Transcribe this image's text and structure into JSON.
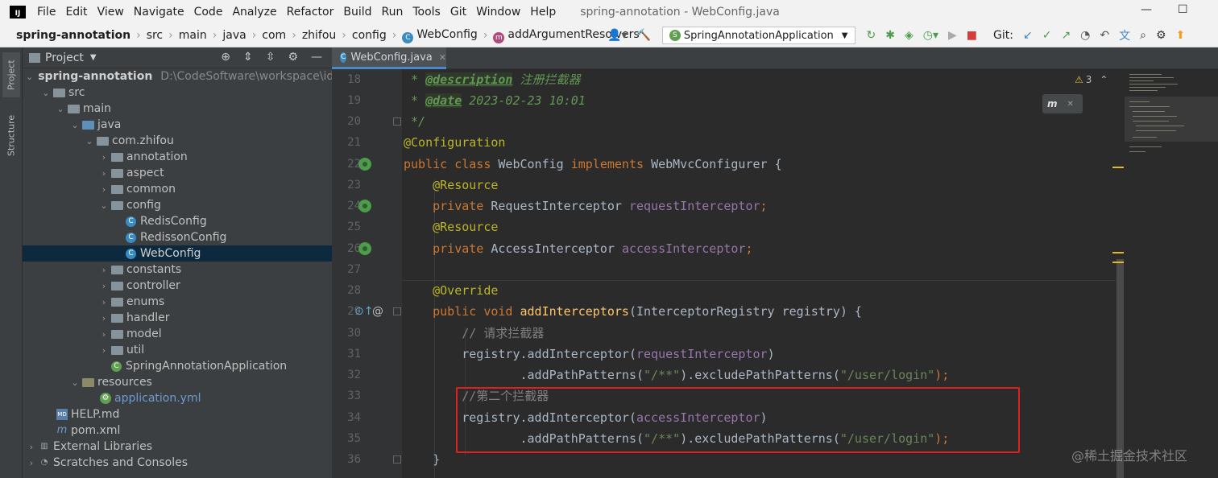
{
  "menubar": {
    "logo": "IJ",
    "items": [
      "File",
      "Edit",
      "View",
      "Navigate",
      "Code",
      "Analyze",
      "Refactor",
      "Build",
      "Run",
      "Tools",
      "Git",
      "Window",
      "Help"
    ],
    "title": "spring-annotation - WebConfig.java",
    "minimize": "—",
    "maximize": "☐"
  },
  "navbar": {
    "breadcrumb": [
      "spring-annotation",
      "src",
      "main",
      "java",
      "com",
      "zhifou",
      "config",
      "WebConfig",
      "addArgumentResolvers"
    ],
    "run_config": "SpringAnnotationApplication",
    "git_label": "Git:"
  },
  "left_strip": {
    "project_tab": "Project",
    "structure_tab": "Structure"
  },
  "project_panel": {
    "title": "Project",
    "rows": [
      {
        "label": "spring-annotation",
        "path": "D:\\CodeSoftware\\workspace\\idea"
      },
      {
        "label": "src"
      },
      {
        "label": "main"
      },
      {
        "label": "java"
      },
      {
        "label": "com.zhifou"
      },
      {
        "label": "annotation"
      },
      {
        "label": "aspect"
      },
      {
        "label": "common"
      },
      {
        "label": "config"
      },
      {
        "label": "RedisConfig"
      },
      {
        "label": "RedissonConfig"
      },
      {
        "label": "WebConfig"
      },
      {
        "label": "constants"
      },
      {
        "label": "controller"
      },
      {
        "label": "enums"
      },
      {
        "label": "handler"
      },
      {
        "label": "model"
      },
      {
        "label": "util"
      },
      {
        "label": "SpringAnnotationApplication"
      },
      {
        "label": "resources"
      },
      {
        "label": "application.yml"
      },
      {
        "label": "HELP.md"
      },
      {
        "label": "pom.xml"
      },
      {
        "label": "External Libraries"
      },
      {
        "label": "Scratches and Consoles"
      }
    ]
  },
  "editor": {
    "tab_label": "WebConfig.java",
    "line_numbers": [
      "18",
      "19",
      "20",
      "21",
      "22",
      "23",
      "24",
      "25",
      "26",
      "27",
      "28",
      "29",
      "30",
      "31",
      "32",
      "33",
      "34",
      "35",
      "36"
    ],
    "warnings_count": "3",
    "code": {
      "l18": {
        "prefix": " * ",
        "tag": "@description",
        "text": " 注册拦截器"
      },
      "l19": {
        "prefix": " * ",
        "tag": "@date",
        "text": " 2023-02-23 10:01"
      },
      "l20": {
        "text": " */"
      },
      "l21": {
        "ann": "@Configuration"
      },
      "l22": {
        "kw1": "public class ",
        "name": "WebConfig ",
        "kw2": "implements ",
        "iface": "WebMvcConfigurer {"
      },
      "l23": {
        "ann": "@Resource"
      },
      "l24": {
        "kw": "private ",
        "type": "RequestInterceptor ",
        "field": "requestInterceptor",
        "end": ";"
      },
      "l25": {
        "ann": "@Resource"
      },
      "l26": {
        "kw": "private ",
        "type": "AccessInterceptor ",
        "field": "accessInterceptor",
        "end": ";"
      },
      "l28": {
        "ann": "@Override"
      },
      "l29": {
        "kw": "public void ",
        "method": "addInterceptors",
        "rest": "(InterceptorRegistry registry) {"
      },
      "l30": {
        "comment": "// 请求拦截器"
      },
      "l31": {
        "pre": "registry.addInterceptor(",
        "field": "requestInterceptor",
        "post": ")"
      },
      "l32": {
        "pre": ".addPathPatterns(",
        "s1": "\"/**\"",
        "mid": ").excludePathPatterns(",
        "s2": "\"/user/login\"",
        "post": ");"
      },
      "l33": {
        "comment": "//第二个拦截器"
      },
      "l34": {
        "pre": "registry.addInterceptor(",
        "field": "accessInterceptor",
        "post": ")"
      },
      "l35": {
        "pre": ".addPathPatterns(",
        "s1": "\"/**\"",
        "mid": ").excludePathPatterns(",
        "s2": "\"/user/login\"",
        "post": ");"
      },
      "l36": {
        "text": "}"
      }
    }
  },
  "watermark": "@稀土掘金技术社区",
  "colors": {
    "keyword": "#cc7832",
    "annotation": "#bbb529",
    "field": "#9876aa",
    "string": "#6a8759",
    "highlight_box": "#e02020"
  }
}
